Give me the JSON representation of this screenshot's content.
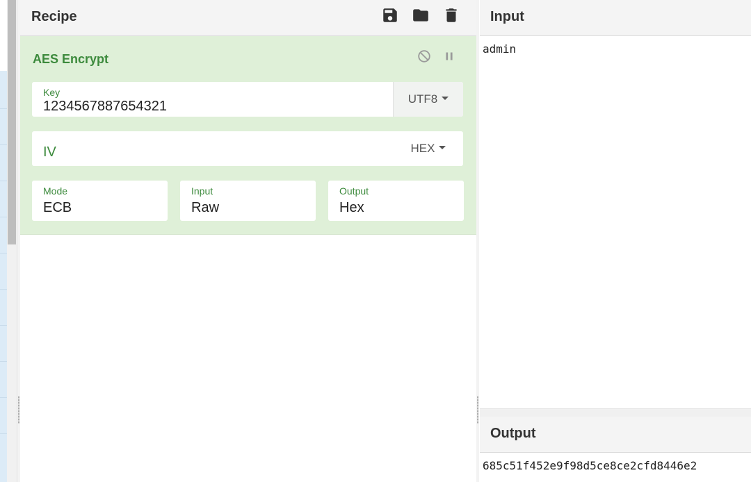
{
  "recipe": {
    "title": "Recipe",
    "icons": [
      "save-icon",
      "folder-icon",
      "trash-icon"
    ]
  },
  "operation": {
    "name": "AES Encrypt",
    "disable_icon": "disable-icon",
    "pause_icon": "pause-icon",
    "key": {
      "label": "Key",
      "value": "1234567887654321",
      "encoding": "UTF8"
    },
    "iv": {
      "label": "IV",
      "value": "",
      "encoding": "HEX"
    },
    "mode": {
      "label": "Mode",
      "value": "ECB"
    },
    "input": {
      "label": "Input",
      "value": "Raw"
    },
    "output": {
      "label": "Output",
      "value": "Hex"
    },
    "accent_color": "#3c8a3c",
    "background_color": "#dff0d8"
  },
  "input_panel": {
    "title": "Input",
    "text": "admin"
  },
  "output_panel": {
    "title": "Output",
    "text": "685c51f452e9f98d5ce8ce2cfd8446e2"
  }
}
